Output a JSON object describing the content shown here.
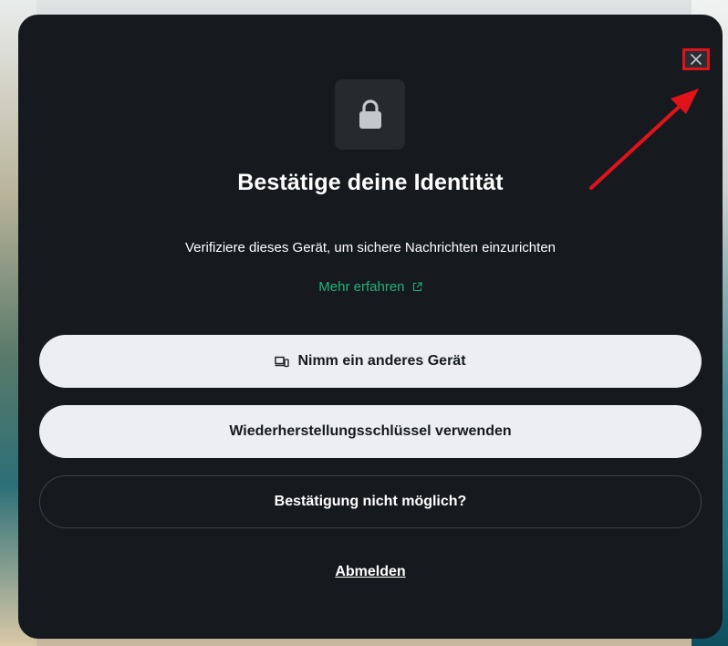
{
  "dialog": {
    "title": "Bestätige deine Identität",
    "subtitle": "Verifiziere dieses Gerät, um sichere Nachrichten einzurichten",
    "learn_more_label": "Mehr erfahren",
    "learn_more_icon": "external-link-icon",
    "lock_icon": "lock-icon",
    "close_icon": "close-icon",
    "accent_color": "#1fb27a",
    "background_color": "#16191e"
  },
  "actions": {
    "other_device_label": "Nimm ein anderes Gerät",
    "other_device_icon": "devices-icon",
    "recovery_key_label": "Wiederherstellungsschlüssel verwenden",
    "cant_confirm_label": "Bestätigung nicht möglich?",
    "sign_out_label": "Abmelden"
  },
  "annotation": {
    "highlight_color": "#e0131b"
  }
}
